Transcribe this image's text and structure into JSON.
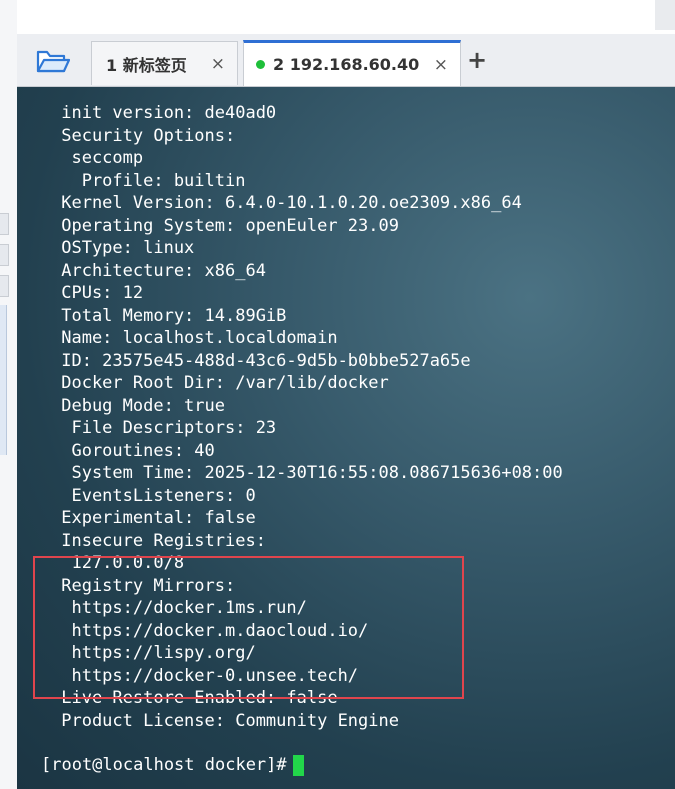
{
  "tabs": [
    {
      "label": "1 新标签页",
      "active": false
    },
    {
      "label": "2 192.168.60.40",
      "active": true,
      "connected": true
    }
  ],
  "icons": {
    "open_session": "folder-open-icon",
    "add_tab": "+",
    "close_tab": "×"
  },
  "colors": {
    "tab_active_accent": "#2f6fd4",
    "status_dot": "#1fbf3a",
    "terminal_text": "#ffffff",
    "cursor": "#22d64a",
    "highlight_box": "#e0454d"
  },
  "terminal": {
    "lines": [
      " init version: de40ad0",
      " Security Options:",
      "  seccomp",
      "   Profile: builtin",
      " Kernel Version: 6.4.0-10.1.0.20.oe2309.x86_64",
      " Operating System: openEuler 23.09",
      " OSType: linux",
      " Architecture: x86_64",
      " CPUs: 12",
      " Total Memory: 14.89GiB",
      " Name: localhost.localdomain",
      " ID: 23575e45-488d-43c6-9d5b-b0bbe527a65e",
      " Docker Root Dir: /var/lib/docker",
      " Debug Mode: true",
      "  File Descriptors: 23",
      "  Goroutines: 40",
      "  System Time: 2025-12-30T16:55:08.086715636+08:00",
      "  EventsListeners: 0",
      " Experimental: false",
      " Insecure Registries:",
      "  127.0.0.0/8",
      " Registry Mirrors:",
      "  https://docker.1ms.run/",
      "  https://docker.m.daocloud.io/",
      "  https://lispy.org/",
      "  https://docker-0.unsee.tech/",
      " Live Restore Enabled: false",
      " Product License: Community Engine"
    ],
    "prompt": "[root@localhost docker]#"
  }
}
